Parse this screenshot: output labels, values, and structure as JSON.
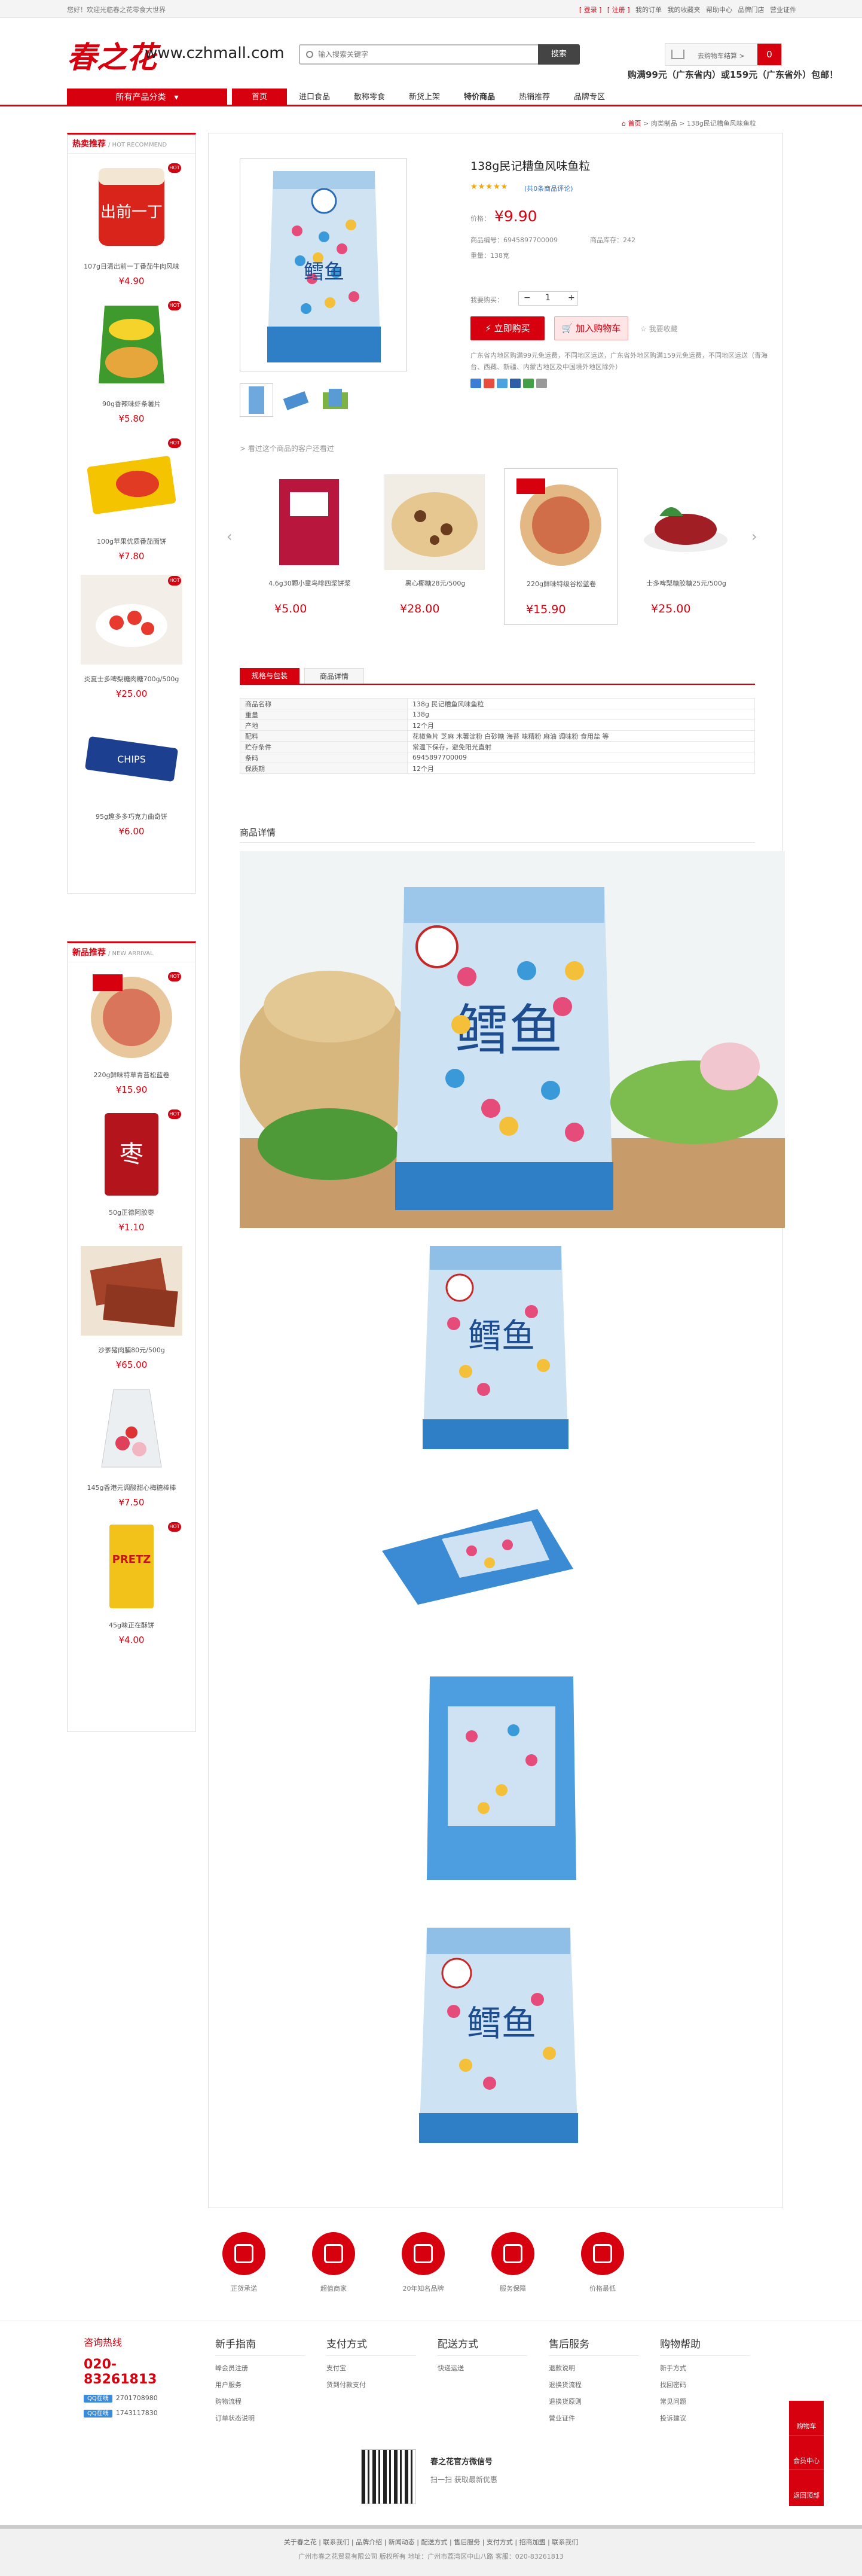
{
  "topbar": {
    "welcome": "您好！欢迎光临春之花零食大世界",
    "links": [
      "[ 登录 ]",
      "[ 注册 ]",
      "我的订单",
      "我的收藏夹",
      "帮助中心",
      "品牌门店",
      "营业证件"
    ]
  },
  "header": {
    "logo_cn": "春之花",
    "logo_url": "www.czhmall.com",
    "search_placeholder": "输入搜索关键字",
    "search_button": "搜索",
    "cart_label": "去购物车结算 >",
    "cart_count": "0",
    "free_shipping": "购满99元（广东省内）或159元（广东省外）包邮！"
  },
  "nav": {
    "category_button": "所有产品分类",
    "items": [
      "首页",
      "进口食品",
      "散称零食",
      "新货上架",
      "特价商品",
      "热销推荐",
      "品牌专区"
    ]
  },
  "breadcrumb": {
    "home": "首页",
    "items": [
      "> 肉类制品",
      "> 138g民记糟鱼风味鱼粒"
    ]
  },
  "hot": {
    "title": "热卖推荐",
    "subtitle": "/ HOT RECOMMEND",
    "items": [
      {
        "name": "107g日清出前一丁番茄牛肉风味",
        "price": "¥4.90",
        "hot": "HOT"
      },
      {
        "name": "90g香辣味虾条薯片",
        "price": "¥5.80",
        "hot": "HOT"
      },
      {
        "name": "100g苹果优质番茄面饼",
        "price": "¥7.80",
        "hot": "HOT"
      },
      {
        "name": "炎夏士多啤梨糖肉糖700g/500g",
        "price": "¥25.00",
        "hot": "HOT"
      },
      {
        "name": "95g趣多多巧克力曲奇饼",
        "price": "¥6.00",
        "hot": ""
      }
    ]
  },
  "new_arrival": {
    "title": "新品推荐",
    "subtitle": "/ NEW ARRIVAL",
    "items": [
      {
        "name": "220g鲜味特草青苔松蓝卷",
        "price": "¥15.90",
        "hot": "HOT"
      },
      {
        "name": "50g正德阿胶枣",
        "price": "¥1.10",
        "hot": "HOT"
      },
      {
        "name": "沙爹猪肉脯80元/500g",
        "price": "¥65.00",
        "hot": ""
      },
      {
        "name": "145g香港元调酸甜心梅糖棒棒",
        "price": "¥7.50",
        "hot": ""
      },
      {
        "name": "45g味正在酥饼",
        "price": "¥4.00",
        "hot": "HOT"
      }
    ]
  },
  "product": {
    "title": "138g民记糟鱼风味鱼粒",
    "stars": "★★★★★",
    "reviews": "(共0条商品评论)",
    "price_label": "价格：",
    "price": "¥9.90",
    "sku_label": "商品编号：6945897700009",
    "stock_label": "商品库存：242",
    "weight_label": "重量：138克",
    "qty_label": "我要购买：",
    "qty": "1",
    "buy_button": "立即购买",
    "cart_button": "加入购物车",
    "favorite": "☆ 我要收藏",
    "shipping": "广东省内地区购满99元免运费，不同地区运送，广东省外地区购满159元免运费，不同地区运送（青海台、西藏、新疆、内蒙古地区及中国境外地区除外）"
  },
  "related": {
    "title": "> 看过这个商品的客户还看过",
    "items": [
      {
        "name": "4.6g30颗小童鸟啡四浆饼浆",
        "price": "¥5.00"
      },
      {
        "name": "黑心椰糖28元/500g",
        "price": "¥28.00"
      },
      {
        "name": "220g鲜味特级谷松蓝卷",
        "price": "¥15.90"
      },
      {
        "name": "士多啤梨糖胶糖25元/500g",
        "price": "¥25.00"
      }
    ]
  },
  "spec": {
    "tabs": [
      "规格与包装",
      "商品详情"
    ],
    "rows": [
      [
        "商品名称",
        "138g 民记糟鱼风味鱼粒"
      ],
      [
        "重量",
        "138g"
      ],
      [
        "产地",
        "12个月"
      ],
      [
        "配料",
        "花椒鱼片 芝麻 木薯淀粉 白砂糖 海苔 味精粉 麻油 调味粉 食用盐 等"
      ],
      [
        "贮存条件",
        "常温下保存，避免阳光直射"
      ],
      [
        "条码",
        "6945897700009"
      ],
      [
        "保质期",
        "12个月"
      ]
    ],
    "detail_title": "商品详情"
  },
  "services": [
    "正货承诺",
    "超值商家",
    "20年知名品牌",
    "服务保障",
    "价格最低"
  ],
  "footer": {
    "hotline_title": "咨询热线",
    "hotline": "020-83261813",
    "qq": [
      [
        "QQ在线",
        "2701708980"
      ],
      [
        "QQ在线",
        "1743117830"
      ]
    ],
    "cols": [
      {
        "title": "新手指南",
        "items": [
          "峰会员注册",
          "用户服务",
          "购物流程",
          "订单状态说明"
        ]
      },
      {
        "title": "支付方式",
        "items": [
          "支付宝",
          "货到付款支付"
        ]
      },
      {
        "title": "配送方式",
        "items": [
          "快递运送"
        ]
      },
      {
        "title": "售后服务",
        "items": [
          "退款说明",
          "退换货流程",
          "退换货原则",
          "营业证件"
        ]
      },
      {
        "title": "购物帮助",
        "items": [
          "新手方式",
          "找回密码",
          "常见问题",
          "投诉建议"
        ]
      }
    ],
    "qr_title": "春之花官方微信号",
    "qr_sub": "扫一扫  获取最新优惠",
    "side": [
      "购物车",
      "会员中心",
      "返回顶部"
    ],
    "bottom_links": "关于春之花 | 联系我们 | 品牌介绍 | 新闻动态 | 配送方式 | 售后服务 | 支付方式 | 招商加盟 | 联系我们",
    "copyright": "广州市春之花贸易有限公司 版权所有 地址：广州市荔湾区中山八路 客服：020-83261813"
  },
  "colors": {
    "brand": "#d7000f",
    "accent_star": "#f7a500"
  }
}
